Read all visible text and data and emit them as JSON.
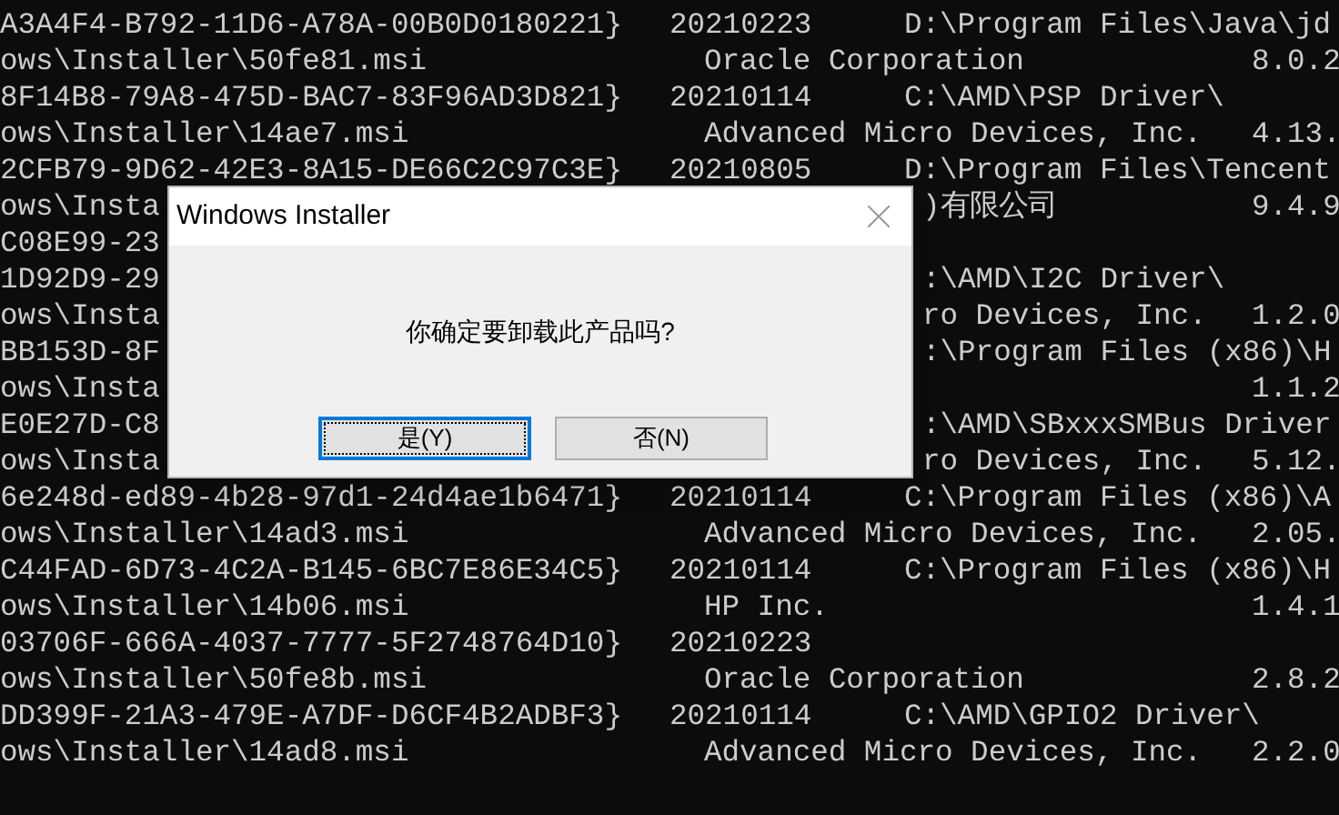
{
  "console": {
    "lines": [
      {
        "kind": "guid",
        "id": "A3A4F4-B792-11D6-A78A-00B0D0180221}",
        "date": "20210223",
        "path": "D:\\Program Files\\Java\\jd"
      },
      {
        "kind": "file",
        "file": "ows\\Installer\\50fe81.msi",
        "publisher": "Oracle Corporation",
        "version": "8.0.2"
      },
      {
        "kind": "guid",
        "id": "8F14B8-79A8-475D-BAC7-83F96AD3D821}",
        "date": "20210114",
        "path": "C:\\AMD\\PSP Driver\\"
      },
      {
        "kind": "file",
        "file": "ows\\Installer\\14ae7.msi",
        "publisher": "Advanced Micro Devices, Inc.",
        "version": "4.13."
      },
      {
        "kind": "guid",
        "id": "2CFB79-9D62-42E3-8A15-DE66C2C97C3E}",
        "date": "20210805",
        "path": "D:\\Program Files\\Tencent"
      },
      {
        "kind": "cut_file",
        "file": "ows\\Insta",
        "publisher": ")有限公司",
        "version": "9.4.9"
      },
      {
        "kind": "cut_guid",
        "id": "C08E99-23"
      },
      {
        "kind": "cut_guid",
        "id": "1D92D9-29",
        "path": ":\\AMD\\I2C Driver\\"
      },
      {
        "kind": "cut_file",
        "file": "ows\\Insta",
        "publisher": "ro Devices, Inc.",
        "version": "1.2.0"
      },
      {
        "kind": "cut_guid",
        "id": "BB153D-8F",
        "path": ":\\Program Files (x86)\\H"
      },
      {
        "kind": "cut_file",
        "file": "ows\\Insta",
        "version": "1.1.2"
      },
      {
        "kind": "cut_guid",
        "id": "E0E27D-C8",
        "path": ":\\AMD\\SBxxxSMBus Driver"
      },
      {
        "kind": "cut_file",
        "file": "ows\\Insta",
        "publisher": "ro Devices, Inc.",
        "version": "5.12."
      },
      {
        "kind": "guid",
        "id": "6e248d-ed89-4b28-97d1-24d4ae1b6471}",
        "date": "20210114",
        "path": "C:\\Program Files (x86)\\A"
      },
      {
        "kind": "file",
        "file": "ows\\Installer\\14ad3.msi",
        "publisher": "Advanced Micro Devices, Inc.",
        "version": "2.05."
      },
      {
        "kind": "guid",
        "id": "C44FAD-6D73-4C2A-B145-6BC7E86E34C5}",
        "date": "20210114",
        "path": "C:\\Program Files (x86)\\H"
      },
      {
        "kind": "file",
        "file": "ows\\Installer\\14b06.msi",
        "publisher": "HP Inc.",
        "version": "1.4.1"
      },
      {
        "kind": "guid",
        "id": "03706F-666A-4037-7777-5F2748764D10}",
        "date": "20210223"
      },
      {
        "kind": "file",
        "file": "ows\\Installer\\50fe8b.msi",
        "publisher": "Oracle Corporation",
        "version": "2.8.2"
      },
      {
        "kind": "guid",
        "id": "DD399F-21A3-479E-A7DF-D6CF4B2ADBF3}",
        "date": "20210114",
        "path": "C:\\AMD\\GPIO2 Driver\\"
      },
      {
        "kind": "file",
        "file": "ows\\Installer\\14ad8.msi",
        "publisher": "Advanced Micro Devices, Inc.",
        "version": "2.2.0"
      }
    ]
  },
  "dialog": {
    "title": "Windows Installer",
    "message": "你确定要卸载此产品吗?",
    "buttons": [
      {
        "label": "是(Y)",
        "selected": true
      },
      {
        "label": "否(N)",
        "selected": false
      }
    ]
  }
}
